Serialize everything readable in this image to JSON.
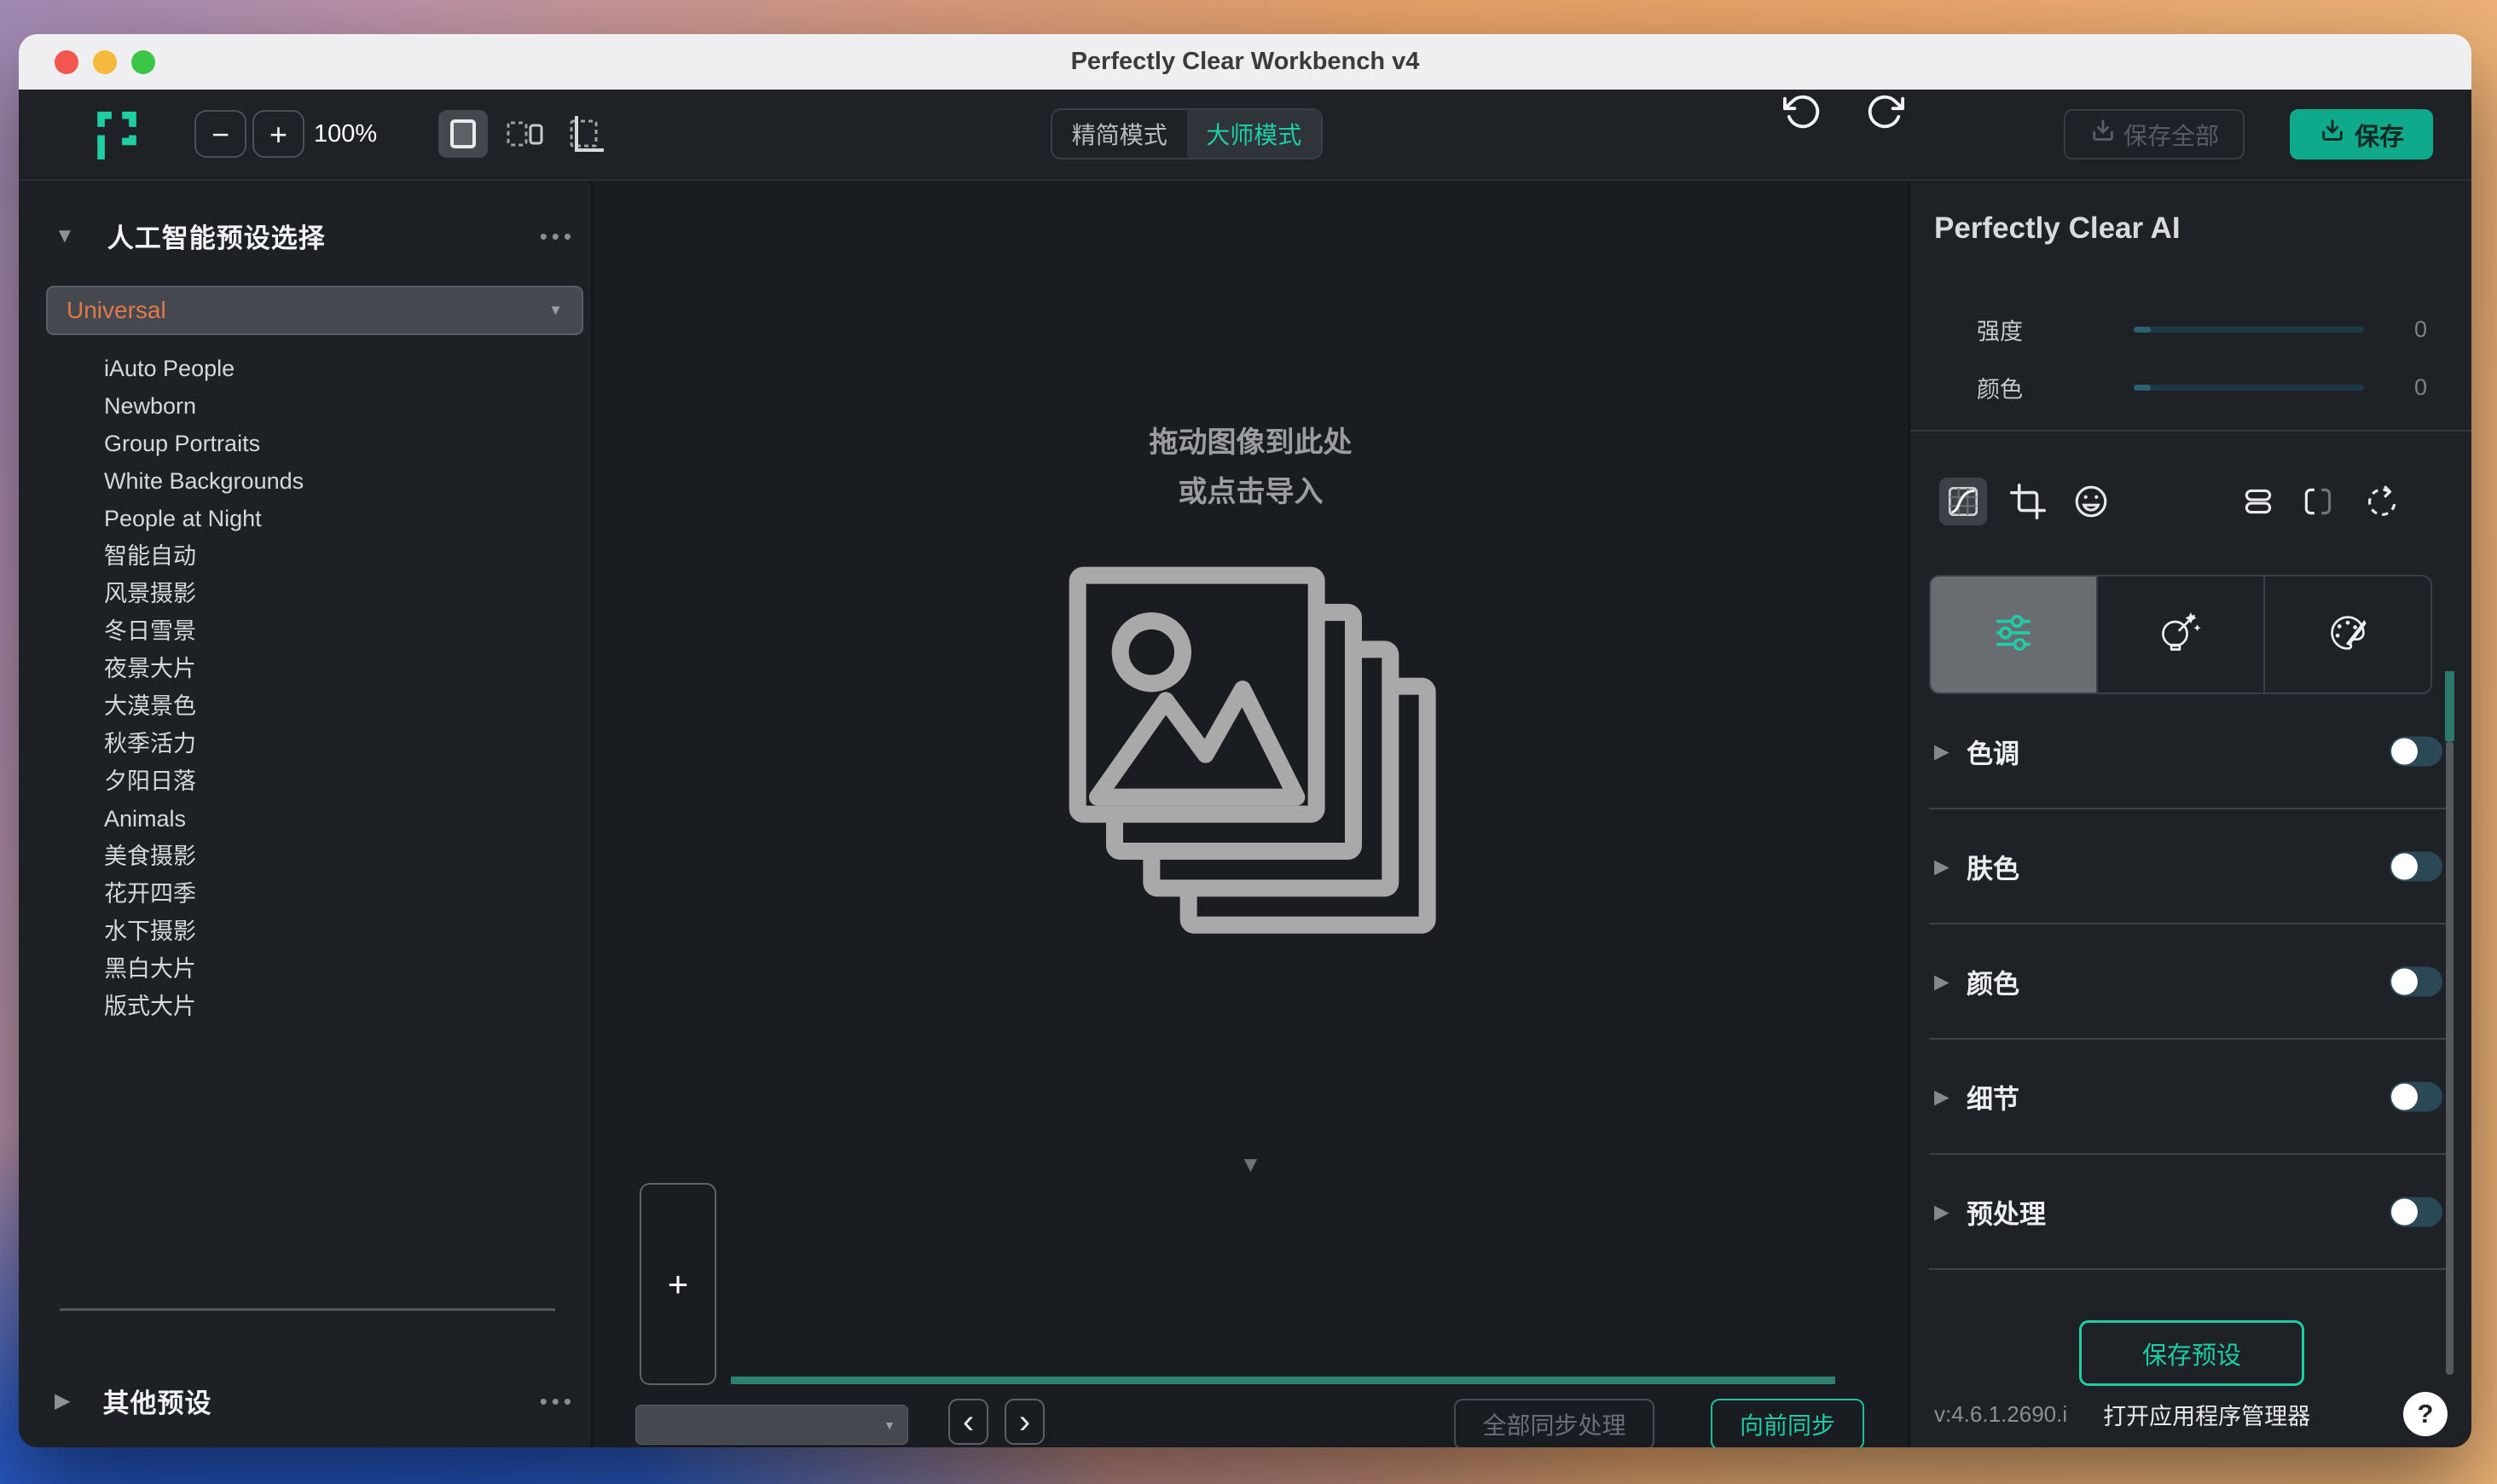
{
  "window": {
    "title": "Perfectly Clear Workbench v4"
  },
  "toolbar": {
    "zoom_out": "−",
    "zoom_in": "+",
    "zoom_level": "100%",
    "mode_toggle": {
      "simple": "精简模式",
      "master": "大师模式"
    },
    "save_all": "保存全部",
    "save": "保存"
  },
  "sidebar": {
    "collapse_glyph": "▼",
    "header": "人工智能预设选择",
    "more_glyph": "•••",
    "preset_group": "Universal",
    "dropdown_glyph": "▼",
    "presets": [
      "iAuto People",
      "Newborn",
      "Group Portraits",
      "White Backgrounds",
      "People at Night",
      "智能自动",
      "风景摄影",
      "冬日雪景",
      "夜景大片",
      "大漠景色",
      "秋季活力",
      "夕阳日落",
      "Animals",
      "美食摄影",
      "花开四季",
      "水下摄影",
      "黑白大片",
      "版式大片"
    ],
    "expand_glyph": "▶",
    "other_header": "其他预设"
  },
  "canvas": {
    "drop_line1": "拖动图像到此处",
    "drop_line2": "或点击导入",
    "handle_glyph": "▼",
    "add_glyph": "+"
  },
  "bottombar": {
    "chevron_left": "‹",
    "chevron_right": "›",
    "sync_all": "全部同步处理",
    "sync_forward": "向前同步"
  },
  "panel": {
    "title": "Perfectly Clear AI",
    "sliders": [
      {
        "label": "强度",
        "value": "0"
      },
      {
        "label": "颜色",
        "value": "0"
      }
    ],
    "expand_glyph": "▶",
    "sections": [
      {
        "label": "色调"
      },
      {
        "label": "肤色"
      },
      {
        "label": "颜色"
      },
      {
        "label": "细节"
      },
      {
        "label": "预处理"
      }
    ],
    "save_preset": "保存预设",
    "version": "v:4.6.1.2690.i",
    "open_app_manager": "打开应用程序管理器",
    "help_glyph": "?"
  },
  "colors": {
    "accent_teal": "#1ecda6",
    "save_button_teal": "#0fa98c",
    "selected_preset_orange": "#e2794a",
    "progress_teal": "#2e8170"
  }
}
